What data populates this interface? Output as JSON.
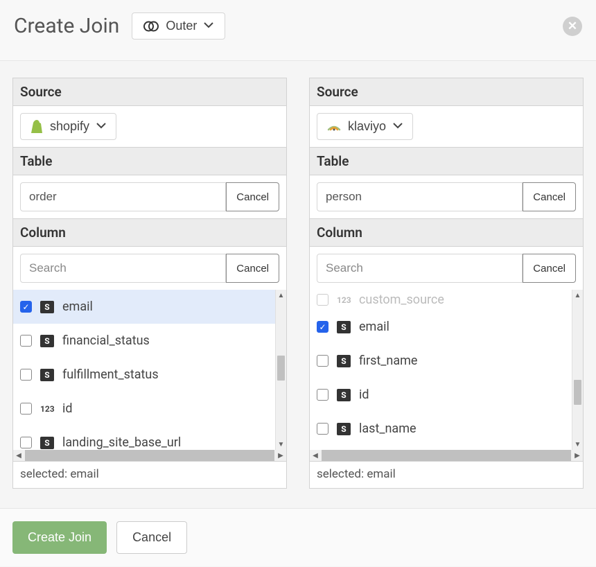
{
  "header": {
    "title": "Create Join",
    "join_type": "Outer"
  },
  "left": {
    "source_label": "Source",
    "source_name": "shopify",
    "table_label": "Table",
    "table_value": "order",
    "table_cancel": "Cancel",
    "column_label": "Column",
    "search_placeholder": "Search",
    "search_cancel": "Cancel",
    "columns": [
      {
        "name": "email",
        "type": "S",
        "checked": true
      },
      {
        "name": "financial_status",
        "type": "S",
        "checked": false
      },
      {
        "name": "fulfillment_status",
        "type": "S",
        "checked": false
      },
      {
        "name": "id",
        "type": "123",
        "checked": false
      },
      {
        "name": "landing_site_base_url",
        "type": "S",
        "checked": false
      }
    ],
    "selected_text": "selected: email"
  },
  "right": {
    "source_label": "Source",
    "source_name": "klaviyo",
    "table_label": "Table",
    "table_value": "person",
    "table_cancel": "Cancel",
    "column_label": "Column",
    "search_placeholder": "Search",
    "search_cancel": "Cancel",
    "columns_top_dim": {
      "name": "custom_source",
      "type": "123"
    },
    "columns": [
      {
        "name": "email",
        "type": "S",
        "checked": true
      },
      {
        "name": "first_name",
        "type": "S",
        "checked": false
      },
      {
        "name": "id",
        "type": "S",
        "checked": false
      },
      {
        "name": "last_name",
        "type": "S",
        "checked": false
      }
    ],
    "selected_text": "selected: email"
  },
  "footer": {
    "primary": "Create Join",
    "secondary": "Cancel"
  }
}
